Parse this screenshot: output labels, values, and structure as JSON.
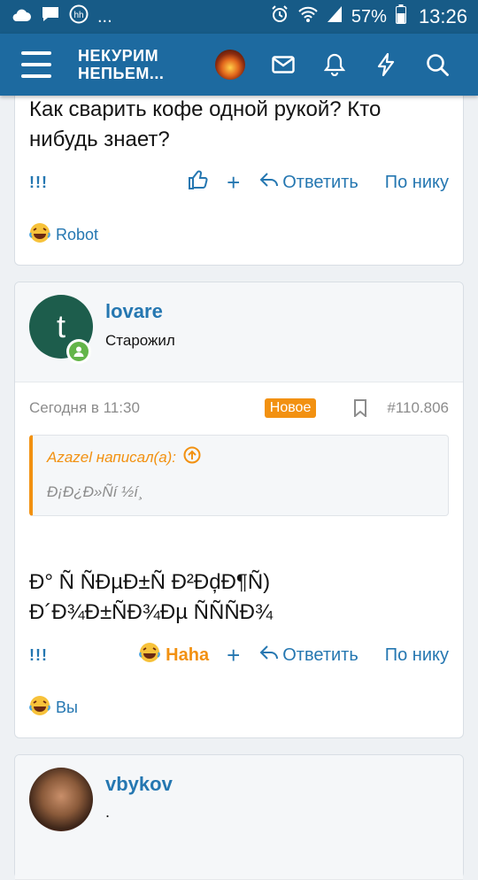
{
  "status_bar": {
    "dots": "...",
    "battery": "57%",
    "time": "13:26"
  },
  "app_bar": {
    "logo_line1": "НЕКУРИМ",
    "logo_line2": "НЕПЬЕМ..."
  },
  "posts": [
    {
      "text_line1": "Как сварить кофе одной рукой? Кто",
      "text_line2": "нибудь знает?",
      "more": "!!!",
      "reply_label": "Ответить",
      "by_nick_label": "По нику",
      "reaction_user": "Robot"
    },
    {
      "username": "lovare",
      "user_title": "Старожил",
      "avatar_letter": "t",
      "date": "Сегодня в 11:30",
      "badge": "Новое",
      "post_number": "#110.806",
      "quote_author": "Azazel написал(a):",
      "quote_text": "Đ¡Đ¿Đ»Ñí ½í¸",
      "text_line1": "Đ° Ñ ÑĐµĐ±Ñ Đ²ĐḑĐ¶Ñ)",
      "text_line2": "Đ´Đ¾Đ±ÑĐ¾Đµ ÑÑÑĐ¾",
      "more": "!!!",
      "reaction_label": "Haha",
      "reply_label": "Ответить",
      "by_nick_label": "По нику",
      "reaction_user": "Вы"
    },
    {
      "username": "vbykov",
      "user_title": "."
    }
  ],
  "colors": {
    "accent_blue": "#2577b1",
    "header_blue": "#1d6aa0",
    "status_blue": "#175b87",
    "orange": "#f29111",
    "online_green": "#63b549"
  },
  "icons": [
    "cloud-icon",
    "message-icon",
    "hh-icon",
    "alarm-icon",
    "wifi-icon",
    "signal-icon",
    "battery-icon",
    "menu-icon",
    "mail-icon",
    "bell-icon",
    "lightning-icon",
    "search-icon",
    "thumbs-up-icon",
    "reply-icon",
    "laughing-emoji-icon",
    "bookmark-icon",
    "arrow-up-circle-icon",
    "online-status-icon"
  ]
}
